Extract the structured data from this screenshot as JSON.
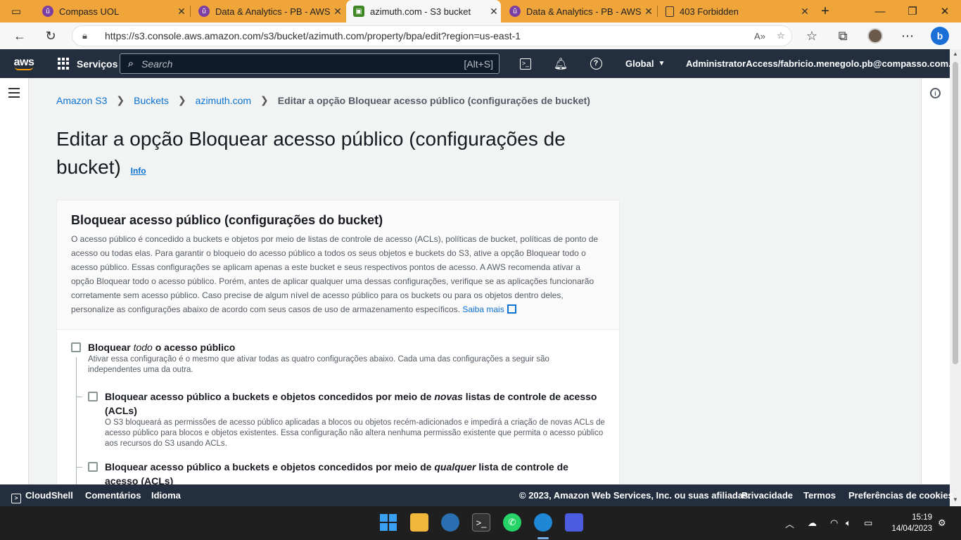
{
  "browser": {
    "tabs": [
      {
        "title": "Compass UOL",
        "icon": "compass-icon",
        "color": "#7b3fa3"
      },
      {
        "title": "Data & Analytics - PB - AWS",
        "icon": "compass-icon",
        "color": "#7b3fa3"
      },
      {
        "title": "azimuth.com - S3 bucket",
        "icon": "s3-icon",
        "color": "#3f8624"
      },
      {
        "title": "Data & Analytics - PB - AWS",
        "icon": "compass-icon",
        "color": "#7b3fa3"
      },
      {
        "title": "403 Forbidden",
        "icon": "page-icon",
        "color": "#555555"
      }
    ],
    "url": "https://s3.console.aws.amazon.com/s3/bucket/azimuth.com/property/bpa/edit?region=us-east-1"
  },
  "aws_header": {
    "logo": "aws",
    "services_label": "Serviços",
    "search_placeholder": "Search",
    "search_shortcut": "[Alt+S]",
    "region": "Global",
    "account": "AdministratorAccess/fabricio.menegolo.pb@compasso.com.br"
  },
  "breadcrumb": {
    "items": [
      "Amazon S3",
      "Buckets",
      "azimuth.com"
    ],
    "current": "Editar a opção Bloquear acesso público (configurações de bucket)"
  },
  "page": {
    "title": "Editar a opção Bloquear acesso público (configurações de bucket)",
    "info_link": "Info"
  },
  "panel": {
    "heading": "Bloquear acesso público (configurações do bucket)",
    "description": "O acesso público é concedido a buckets e objetos por meio de listas de controle de acesso (ACLs), políticas de bucket, políticas de ponto de acesso ou todas elas. Para garantir o bloqueio do acesso público a todos os seus objetos e buckets do S3, ative a opção Bloquear todo o acesso público. Essas configurações se aplicam apenas a este bucket e seus respectivos pontos de acesso. A AWS recomenda ativar a opção Bloquear todo o acesso público. Porém, antes de aplicar qualquer uma dessas configurações, verifique se as aplicações funcionarão corretamente sem acesso público. Caso precise de algum nível de acesso público para os buckets ou para os objetos dentro deles, personalize as configurações abaixo de acordo com seus casos de uso de armazenamento específicos.",
    "learn_more": "Saiba mais",
    "block_all": {
      "title_prefix": "Bloquear ",
      "title_em": "todo",
      "title_suffix": " o acesso público",
      "description": "Ativar essa configuração é o mesmo que ativar todas as quatro configurações abaixo. Cada uma das configurações a seguir são independentes uma da outra.",
      "checked": false
    },
    "option1": {
      "title_prefix": "Bloquear acesso público a buckets e objetos concedidos por meio de ",
      "title_em": "novas",
      "title_suffix": " listas de controle de acesso (ACLs)",
      "description": "O S3 bloqueará as permissões de acesso público aplicadas a blocos ou objetos recém-adicionados e impedirá a criação de novas ACLs de acesso público para blocos e objetos existentes. Essa configuração não altera nenhuma permissão existente que permita o acesso público aos recursos do S3 usando ACLs.",
      "checked": false
    },
    "option2": {
      "title_prefix": "Bloquear acesso público a buckets e objetos concedidos por meio de ",
      "title_em": "qualquer",
      "title_suffix": " lista de controle de acesso (ACLs)",
      "checked": false
    }
  },
  "footer": {
    "cloudshell": "CloudShell",
    "feedback": "Comentários",
    "language": "Idioma",
    "copyright": "© 2023, Amazon Web Services, Inc. ou suas afiliadas.",
    "privacy": "Privacidade",
    "terms": "Termos",
    "cookies": "Preferências de cookies"
  },
  "taskbar": {
    "time": "15:19",
    "date": "14/04/2023"
  }
}
